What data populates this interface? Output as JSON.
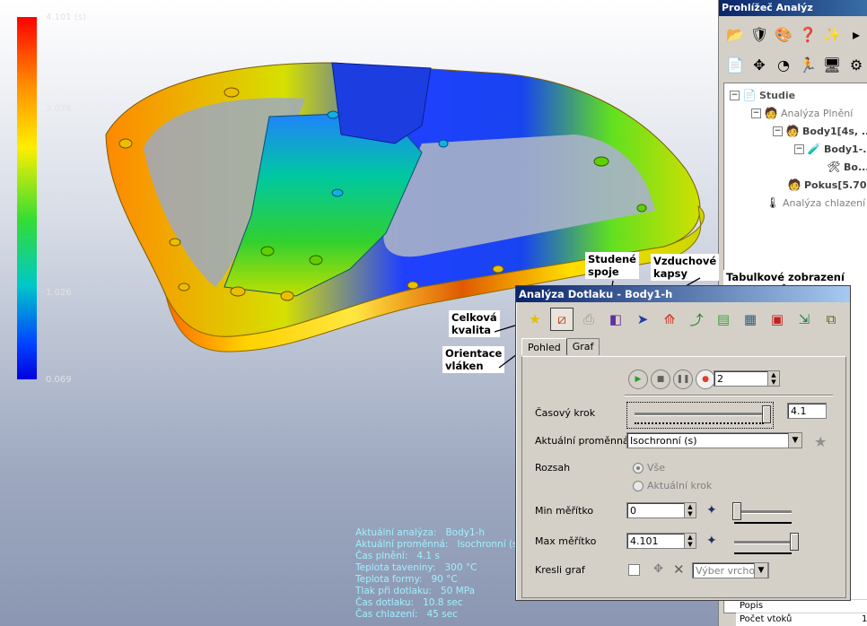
{
  "scale": {
    "max": "4.101 (s)",
    "t1": "3.076",
    "t2": "2.051",
    "t3": "1.026",
    "min": "0.069"
  },
  "info": {
    "lines": [
      {
        "k": "Aktuální analýza:",
        "v": "Body1-h"
      },
      {
        "k": "Aktuální proměnná:",
        "v": "Isochronní (s)"
      },
      {
        "k": "Čas plnění:",
        "v": "4.1 s"
      },
      {
        "k": "Teplota taveniny:",
        "v": "300 °C"
      },
      {
        "k": "Teplota formy:",
        "v": "90 °C"
      },
      {
        "k": "Tlak při dotlaku:",
        "v": "50 MPa"
      },
      {
        "k": "Čas dotlaku:",
        "v": "10.8 sec"
      },
      {
        "k": "Čas chlazení:",
        "v": "45 sec"
      }
    ]
  },
  "callouts": {
    "celkova": "Celková\nkvalita",
    "studene": "Studené\nspoje",
    "vzduchove": "Vzduchové\nkapsy",
    "tabulkove": "Tabulkové zobrazení\nparametrů",
    "orientace": "Orientace\nvláken"
  },
  "panel": {
    "title": "Prohlížeč Analýz",
    "tree": [
      {
        "label": "Studie",
        "style": "bold"
      },
      {
        "label": "Analýza Plnění",
        "style": "gray"
      },
      {
        "label": "Body1[4s, ...",
        "style": "bold"
      },
      {
        "label": "Body1-...",
        "style": "bold"
      },
      {
        "label": "Bo...",
        "style": "bold"
      },
      {
        "label": "Pokus[5.70...",
        "style": "bold"
      },
      {
        "label": "Analýza chlazení",
        "style": "gray"
      }
    ],
    "props": [
      "Popis",
      "Počet vtoků"
    ],
    "prop_val": "1"
  },
  "dialog": {
    "title": "Analýza Dotlaku - Body1-h",
    "tabs": [
      "Pohled",
      "Graf"
    ],
    "step_count": "2",
    "casovy_krok_label": "Časový krok",
    "casovy_krok_value": "4.1",
    "casovy_krok_level": 1.0,
    "aktualni_promenna_label": "Aktuální proměnná",
    "aktualni_promenna_value": "Isochronní (s)",
    "rozsah_label": "Rozsah",
    "rozsah_vse": "Vše",
    "rozsah_aktualni": "Aktuální krok",
    "min_label": "Min měřítko",
    "min_value": "0",
    "min_level": 0.0,
    "max_label": "Max měřítko",
    "max_value": "4.101",
    "max_level": 1.0,
    "kresli_label": "Kresli graf",
    "vyber_placeholder": "Výber vrchol"
  }
}
